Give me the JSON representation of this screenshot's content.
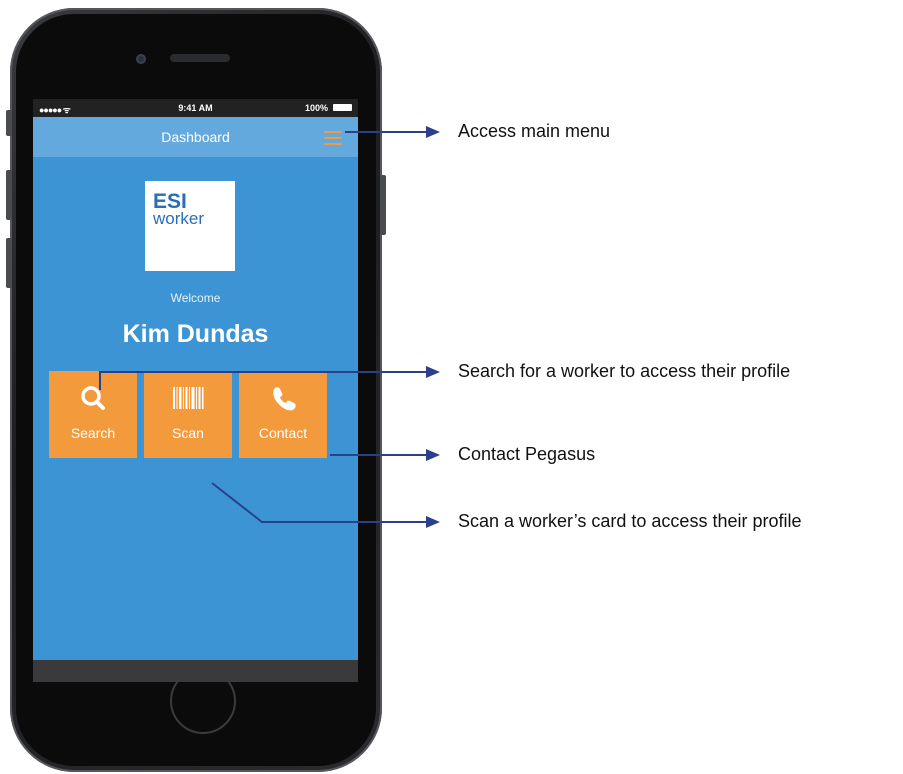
{
  "status_bar": {
    "signal": "●●●●● ᯤ",
    "time": "9:41 AM",
    "battery": "100%"
  },
  "nav": {
    "title": "Dashboard"
  },
  "logo": {
    "line1": "ESI",
    "line2": "worker"
  },
  "welcome_label": "Welcome",
  "user_name": "Kim Dundas",
  "tiles": [
    {
      "label": "Search",
      "icon": "search-icon"
    },
    {
      "label": "Scan",
      "icon": "barcode-icon"
    },
    {
      "label": "Contact",
      "icon": "phone-icon"
    }
  ],
  "callouts": {
    "menu": "Access main menu",
    "search": "Search for a worker to access their profile",
    "contact": "Contact Pegasus",
    "scan": "Scan a worker’s card to access their profile"
  },
  "colors": {
    "screen_bg": "#3d94d4",
    "navbar_bg": "#63a9dd",
    "tile_bg": "#f39a3d",
    "arrow": "#2b3f8a"
  }
}
